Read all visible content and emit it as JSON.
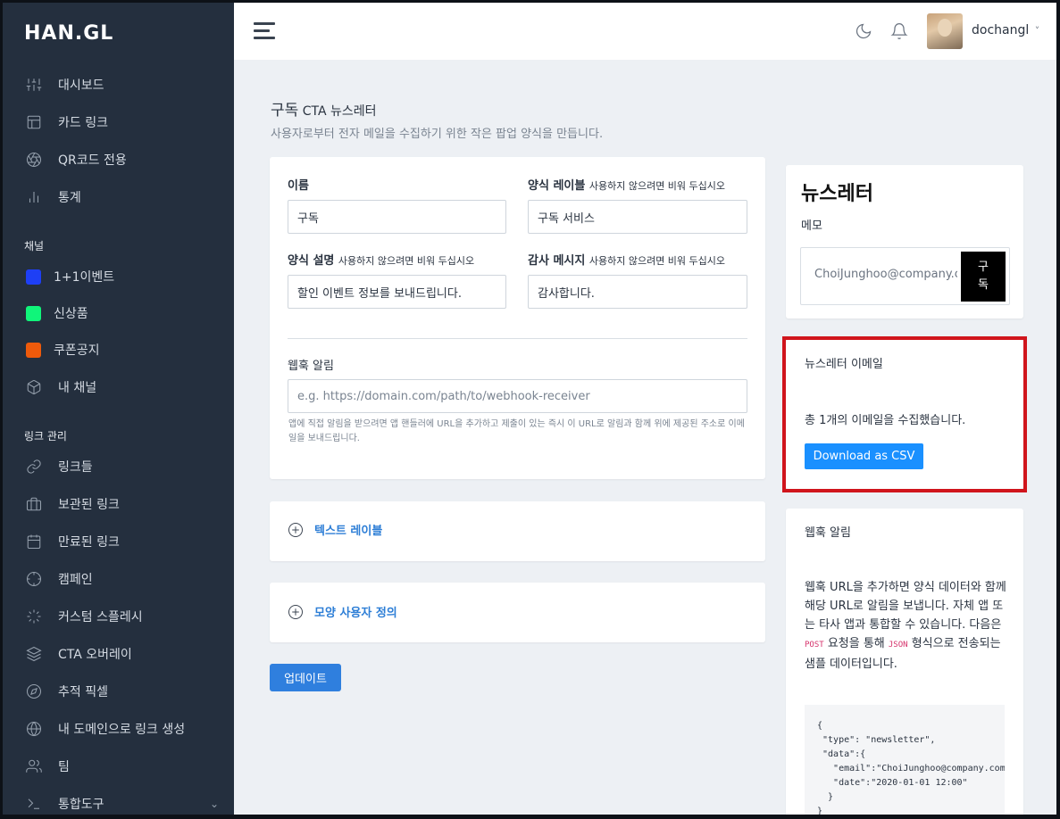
{
  "app": {
    "logo": "HAN.GL"
  },
  "sidebar": {
    "main_items": [
      {
        "label": "대시보드",
        "icon": "sliders-icon"
      },
      {
        "label": "카드 링크",
        "icon": "layout-icon"
      },
      {
        "label": "QR코드 전용",
        "icon": "aperture-icon"
      },
      {
        "label": "통계",
        "icon": "bar-chart-icon"
      }
    ],
    "channels_label": "채널",
    "channels": [
      {
        "label": "1+1이벤트",
        "color": "#1e3ff5"
      },
      {
        "label": "신상품",
        "color": "#10f57a"
      },
      {
        "label": "쿠폰공지",
        "color": "#ee5a0b"
      },
      {
        "label": "내 채널",
        "icon": "box-icon"
      }
    ],
    "links_label": "링크 관리",
    "link_items": [
      {
        "label": "링크들",
        "icon": "link-icon"
      },
      {
        "label": "보관된 링크",
        "icon": "briefcase-icon"
      },
      {
        "label": "만료된 링크",
        "icon": "calendar-icon"
      },
      {
        "label": "캠페인",
        "icon": "crosshair-icon"
      },
      {
        "label": "커스텀 스플레시",
        "icon": "loader-icon"
      },
      {
        "label": "CTA 오버레이",
        "icon": "layers-icon"
      },
      {
        "label": "추적 픽셀",
        "icon": "compass-icon"
      },
      {
        "label": "내 도메인으로 링크 생성",
        "icon": "globe-icon"
      },
      {
        "label": "팀",
        "icon": "users-icon"
      },
      {
        "label": "통합도구",
        "icon": "terminal-icon"
      }
    ]
  },
  "topbar": {
    "username": "dochangl",
    "dropdown_chevron": "˅"
  },
  "page": {
    "title_main": "구독",
    "title_rest": " CTA 뉴스레터",
    "subtitle": "사용자로부터 전자 메일을 수집하기 위한 작은 팝업 양식을 만듭니다."
  },
  "form": {
    "name_label": "이름",
    "name_value": "구독",
    "form_label": "양식 레이블",
    "form_label_hint": "사용하지 않으려면 비워 두십시오",
    "form_label_value": "구독 서비스",
    "desc_label": "양식 설명",
    "desc_hint": "사용하지 않으려면 비워 두십시오",
    "desc_value": "할인 이벤트 정보를 보내드립니다.",
    "thanks_label": "감사 메시지",
    "thanks_hint": "사용하지 않으려면 비워 두십시오",
    "thanks_value": "감사합니다.",
    "webhook_label": "웹훅 알림",
    "webhook_placeholder": "e.g. https://domain.com/path/to/webhook-receiver",
    "webhook_help": "앱에 직접 알림을 받으려면 앱 핸들러에 URL을 추가하고 제출이 있는 즉시 이 URL로 알림과 함께 위에 제공된 주소로 이메일을 보내드립니다."
  },
  "accordions": {
    "text_labels": "텍스트 레이블",
    "appearance": "모양 사용자 정의"
  },
  "update_button": "업데이트",
  "preview": {
    "title": "뉴스레터",
    "memo": "메모",
    "email_placeholder": "ChoiJunghoo@company.com",
    "subscribe_line1": "구",
    "subscribe_line2": "독"
  },
  "emails_panel": {
    "title": "뉴스레터 이메일",
    "count_text": "총 1개의 이메일을 수집했습니다.",
    "download_button": "Download as CSV"
  },
  "webhook_panel": {
    "title": "웹훅 알림",
    "desc_part1": "웹훅 URL을 추가하면 양식 데이터와 함께 해당 URL로 알림을 보냅니다. 자체 앱 또는 타사 앱과 통합할 수 있습니다. 다음은 ",
    "post_tag": "POST",
    "desc_part2": " 요청을 통해 ",
    "json_tag": "JSON",
    "desc_part3": " 형식으로 전송되는 샘플 데이터입니다.",
    "code": "{\n \"type\": \"newsletter\",\n \"data\":{\n   \"email\":\"ChoiJunghoo@company.com\",\n   \"date\":\"2020-01-01 12:00\"\n  }\n}"
  }
}
